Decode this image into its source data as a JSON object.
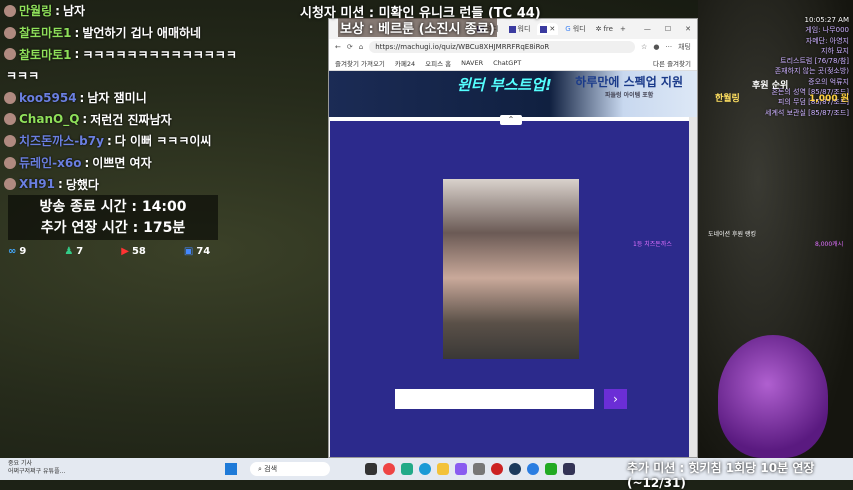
{
  "chat": [
    {
      "nick": "만월링",
      "msg": "남자",
      "color": "green"
    },
    {
      "nick": "찰토마토1",
      "msg": "발언하기 겁나 애매하네",
      "color": "green"
    },
    {
      "nick": "찰토마토1",
      "msg": "ㅋㅋㅋㅋㅋㅋㅋㅋㅋㅋㅋㅋㅋㅋ",
      "color": "green"
    },
    {
      "nick": "",
      "msg": "ㅋㅋㅋ",
      "color": "green"
    },
    {
      "nick": "koo5954",
      "msg": "남자 잼미니",
      "color": "blue"
    },
    {
      "nick": "ChanO_Q",
      "msg": "저런건 진짜남자",
      "color": "green"
    },
    {
      "nick": "치즈돈까스-b7y",
      "msg": "다 이뻐 ㅋㅋㅋ이씨",
      "color": "blue"
    },
    {
      "nick": "듀레인-x6o",
      "msg": "이쁘면 여자",
      "color": "blue"
    },
    {
      "nick": "XH91",
      "msg": "당했다",
      "color": "blue"
    }
  ],
  "chat_separator": ":",
  "broadcast_end": "방송 종료 시간 : 14:00",
  "extension_time": "추가 연장 시간 : 175분",
  "stats": [
    {
      "icon": "link-icon",
      "value": "9"
    },
    {
      "icon": "person-icon",
      "value": "7"
    },
    {
      "icon": "youtube-icon",
      "value": "58"
    },
    {
      "icon": "chat-icon",
      "value": "74"
    }
  ],
  "mission": "시청자 미션 : 미확인 유니크 런들 (TC 44)",
  "reward": "보상 : 베르룬 (소진시 종료)",
  "browser": {
    "tabs": [
      "워디",
      "워디",
      "",
      "워디",
      "fre"
    ],
    "url": "https://machugi.io/quiz/WBCu8XHJMRRFRqE8iRoR",
    "copilot": "채팅",
    "bookmarks": [
      "즐겨찾기 가져오기",
      "카페24",
      "오피스 홈",
      "NAVER",
      "ChatGPT"
    ],
    "other_bookmarks": "다른 즐겨찾기",
    "ad_title": "윈터 부스트업!",
    "ad_right": "하루만에 스펙업 지원",
    "ad_right_small": "파들렁 아이템 포함",
    "submit": "›"
  },
  "right_panel": {
    "time": "10:05:27 AM",
    "lines": [
      "게임: 나무000",
      "자메단: 아영지",
      "지하 묘지",
      "트리스트럼 [76/78/참]",
      "존재하지 않는 곳(젖소방)",
      "증오의 억류지",
      "혼돈의 성역 [85/87/조드]",
      "피의 무덤 [85/87/조드]",
      "세계석 보관실 [85/87/조드]"
    ]
  },
  "rank_title": "후원 순위",
  "rank_name": "한월링",
  "rank_amount": "1,000 원",
  "donation_title": "도네이션 후원 랭킹",
  "donation_first": "1등 치즈돈까스",
  "donation_amount": "8,000캐시",
  "taskbar": {
    "news_title": "중요 기사",
    "news_sub": "어쩌구저쩌구 유튜플...",
    "search": "검색"
  },
  "extra_mission": "추가 미션 : 힛키침 1회당 10분 연장 (~12/31)"
}
